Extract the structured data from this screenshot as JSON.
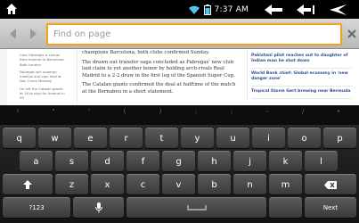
{
  "status_bar": {
    "time": "7:37 AM",
    "icons": [
      "home-icon",
      "wifi-icon",
      "battery-icon",
      "back-icon",
      "menu-icon",
      "return-icon"
    ]
  },
  "find_bar": {
    "placeholder": "Find on page",
    "value": ""
  },
  "article": {
    "sidebar_snippets": [
      "Cesc Fabregas is casual from Arsenal to Barcelona. Both London",
      "Fabregas will undergo medical and sign deal at Nou Camp Monday",
      "He left the Catalan giants at 16 to play for Arsenal in 09"
    ],
    "paragraphs": [
      "champions Barcelona, both clubs confirmed Sunday.",
      "The drawn out transfer saga concluded as Fabregas' new club laid claim to yet another honor by holding arch-rivals Real Madrid to a 2-2 draw in the first leg of the Spanish Super Cup.",
      "The Catalan giants confirmed the deal at halftime of the match at the Bernabeu in a short statement."
    ],
    "right_links": [
      "Pakistani pilot reaches out to daughter of Indian man he shot down",
      "World Bank chief: Global economy in 'new danger zone'",
      "Tropical Storm Gert brewing near Bermuda"
    ]
  },
  "keyboard": {
    "symbols": [
      "!",
      "\"",
      "'",
      "(",
      ")",
      ":",
      ";",
      "-",
      "/",
      "•"
    ],
    "row1": [
      {
        "label": "q",
        "hint": ""
      },
      {
        "label": "w",
        "hint": ""
      },
      {
        "label": "e",
        "hint": ""
      },
      {
        "label": "r",
        "hint": ""
      },
      {
        "label": "t",
        "hint": ""
      },
      {
        "label": "y",
        "hint": ""
      },
      {
        "label": "u",
        "hint": ""
      },
      {
        "label": "i",
        "hint": ""
      },
      {
        "label": "o",
        "hint": ""
      },
      {
        "label": "p",
        "hint": ""
      }
    ],
    "row2": [
      "a",
      "s",
      "d",
      "f",
      "g",
      "h",
      "j",
      "k",
      "l"
    ],
    "row3": [
      "z",
      "x",
      "c",
      "v",
      "b",
      "n",
      "m"
    ],
    "symbols_key": "?123",
    "space_label": "",
    "next_key": "Next"
  }
}
